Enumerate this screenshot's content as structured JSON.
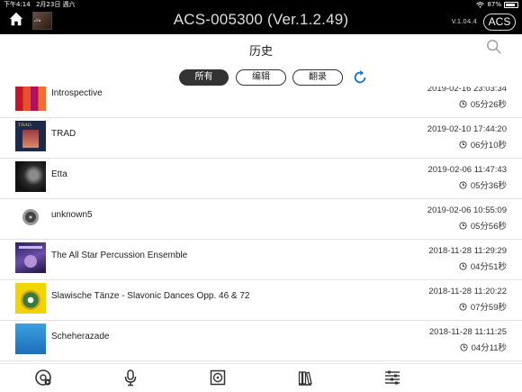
{
  "status": {
    "time": "下午4:14",
    "date": "2月23日 週六",
    "battery": "87%",
    "battery_level": 0.87
  },
  "app": {
    "title": "ACS-005300 (Ver.1.2.49)",
    "version": "V.1.04.4",
    "acs_label": "ACS"
  },
  "header": {
    "title": "历史"
  },
  "filters": [
    {
      "label": "所有",
      "active": true
    },
    {
      "label": "编辑",
      "active": false
    },
    {
      "label": "翻录",
      "active": false
    }
  ],
  "history": [
    {
      "title": "Introspective",
      "date": "2019-02-16 23:03:34",
      "duration": "05分26秒",
      "cover": "stripes"
    },
    {
      "title": "TRAD",
      "date": "2019-02-10 17:44:20",
      "duration": "06分10秒",
      "cover": "trad"
    },
    {
      "title": "Etta",
      "date": "2019-02-06 11:47:43",
      "duration": "05分36秒",
      "cover": "portrait"
    },
    {
      "title": "unknown5",
      "date": "2019-02-06 10:55:09",
      "duration": "05分56秒",
      "cover": "disc"
    },
    {
      "title": "The All Star Percussion Ensemble",
      "date": "2018-11-28 11:29:29",
      "duration": "04分51秒",
      "cover": "purple"
    },
    {
      "title": "Slawische Tänze - Slavonic Dances Opp. 46 & 72",
      "date": "2018-11-28 11:20:22",
      "duration": "07分59秒",
      "cover": "yellow"
    },
    {
      "title": "Scheherazade",
      "date": "2018-11-28 11:11:25",
      "duration": "04分11秒",
      "cover": "blue"
    }
  ],
  "tabs": [
    {
      "icon": "disc-play-icon",
      "active": true
    },
    {
      "icon": "microphone-icon",
      "active": false
    },
    {
      "icon": "album-icon",
      "active": false
    },
    {
      "icon": "library-icon",
      "active": false
    },
    {
      "icon": "settings-sliders-icon",
      "active": false
    }
  ],
  "colors": {
    "accent": "#1e6fd0",
    "topbar": "#000000",
    "active_segment": "#333333"
  }
}
